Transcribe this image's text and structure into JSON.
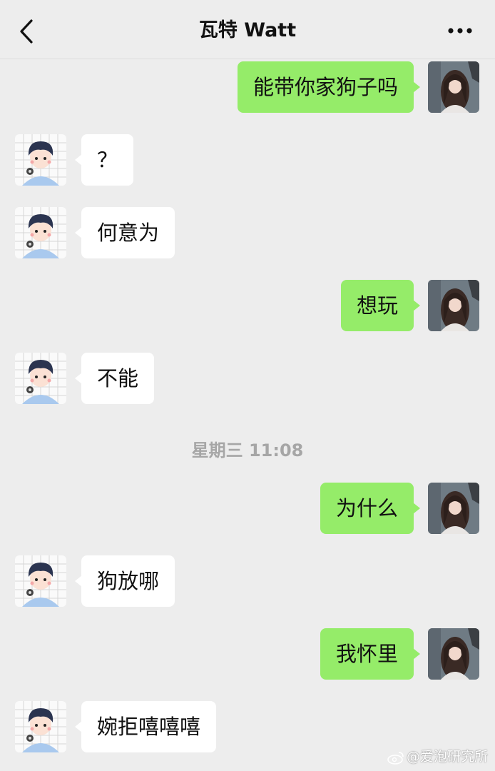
{
  "header": {
    "title": "瓦特 Watt",
    "back_icon": "chevron-left-icon",
    "more_icon": "more-dots-icon"
  },
  "messages": [
    {
      "sender": "me",
      "text": "能带你家狗子吗"
    },
    {
      "sender": "other",
      "text": "？"
    },
    {
      "sender": "other",
      "text": "何意为"
    },
    {
      "sender": "me",
      "text": "想玩"
    },
    {
      "sender": "other",
      "text": "不能"
    },
    {
      "sender": "me",
      "text": "为什么"
    },
    {
      "sender": "other",
      "text": "狗放哪"
    },
    {
      "sender": "me",
      "text": "我怀里"
    },
    {
      "sender": "other",
      "text": "婉拒嘻嘻嘻"
    }
  ],
  "timestamp": "星期三 11:08",
  "watermark": "@爱泡研究所",
  "colors": {
    "background": "#ededed",
    "my_bubble": "#95ec69",
    "other_bubble": "#ffffff",
    "timestamp_text": "#a6a6a6"
  }
}
